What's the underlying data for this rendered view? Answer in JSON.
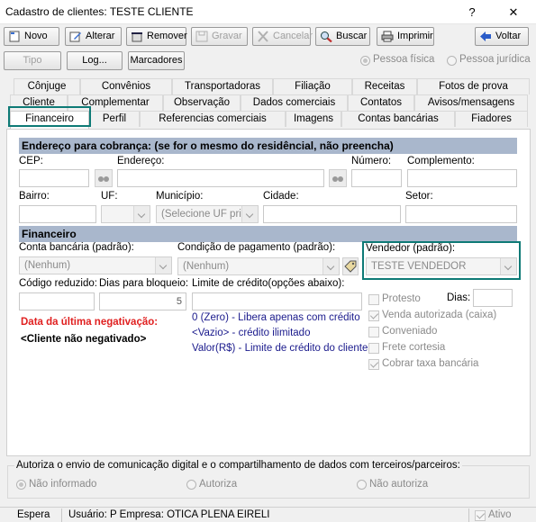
{
  "window": {
    "title": "Cadastro de clientes: TESTE CLIENTE",
    "help": "?",
    "close": "✕"
  },
  "toolbar": {
    "novo": "Novo",
    "alterar": "Alterar",
    "remover": "Remover",
    "gravar": "Gravar",
    "cancelar": "Cancelar",
    "buscar": "Buscar",
    "imprimir": "Imprimir",
    "voltar": "Voltar"
  },
  "subtoolbar": {
    "tipo": "Tipo",
    "log": "Log...",
    "marcadores": "Marcadores",
    "pessoa_fisica": "Pessoa física",
    "pessoa_juridica": "Pessoa jurídica"
  },
  "tabs": {
    "row1": [
      "Cônjuge",
      "Convênios",
      "Transportadoras",
      "Filiação",
      "Receitas",
      "Fotos de prova"
    ],
    "row2": [
      "Cliente",
      "Complementar",
      "Observação",
      "Dados comerciais",
      "Contatos",
      "Avisos/mensagens"
    ],
    "row3": [
      "Financeiro",
      "Perfil",
      "Referencias comerciais",
      "Imagens",
      "Contas bancárias",
      "Fiadores"
    ]
  },
  "endereco": {
    "header": "Endereço para cobrança: (se for o mesmo do residêncial, não preencha)",
    "cep": "CEP:",
    "endereco": "Endereço:",
    "numero": "Número:",
    "complemento": "Complemento:",
    "bairro": "Bairro:",
    "uf": "UF:",
    "municipio": "Município:",
    "municipio_value": "(Selecione UF primeiro)",
    "cidade": "Cidade:",
    "setor": "Setor:"
  },
  "financeiro": {
    "header": "Financeiro",
    "conta_label": "Conta bancária (padrão):",
    "conta_value": "(Nenhum)",
    "condicao_label": "Condição de pagamento (padrão):",
    "condicao_value": "(Nenhum)",
    "vendedor_label": "Vendedor (padrão):",
    "vendedor_value": "TESTE VENDEDOR",
    "codigo_label": "Código reduzido:",
    "dias_label": "Dias para bloqueio:",
    "dias_value": "5",
    "limite_label": "Limite de crédito(opções abaixo):",
    "negativacao_title": "Data da última negativação:",
    "negativacao_value": "<Cliente não negativado>",
    "info1": "0 (Zero) - Libera apenas com crédito",
    "info2": "<Vazio> - crédito ilimitado",
    "info3": "Valor(R$) - Limite de crédito do cliente",
    "protesto": "Protesto",
    "dias": "Dias:",
    "venda_autorizada": "Venda autorizada (caixa)",
    "conveniado": "Conveniado",
    "frete_cortesia": "Frete cortesia",
    "cobrar_taxa": "Cobrar taxa bancária"
  },
  "consent": {
    "title": "Autoriza o envio de comunicação digital e o compartilhamento de dados com terceiros/parceiros:",
    "nao_informado": "Não informado",
    "autoriza": "Autoriza",
    "nao_autoriza": "Não autoriza"
  },
  "status": {
    "espera": "Espera",
    "usuario": "Usuário: P Empresa: OTICA PLENA EIRELI",
    "ativo": "Ativo"
  },
  "colors": {
    "accent": "#0e7a76",
    "section": "#a9b7cc",
    "negativacao": "#e02020",
    "info": "#1a1a8c"
  }
}
